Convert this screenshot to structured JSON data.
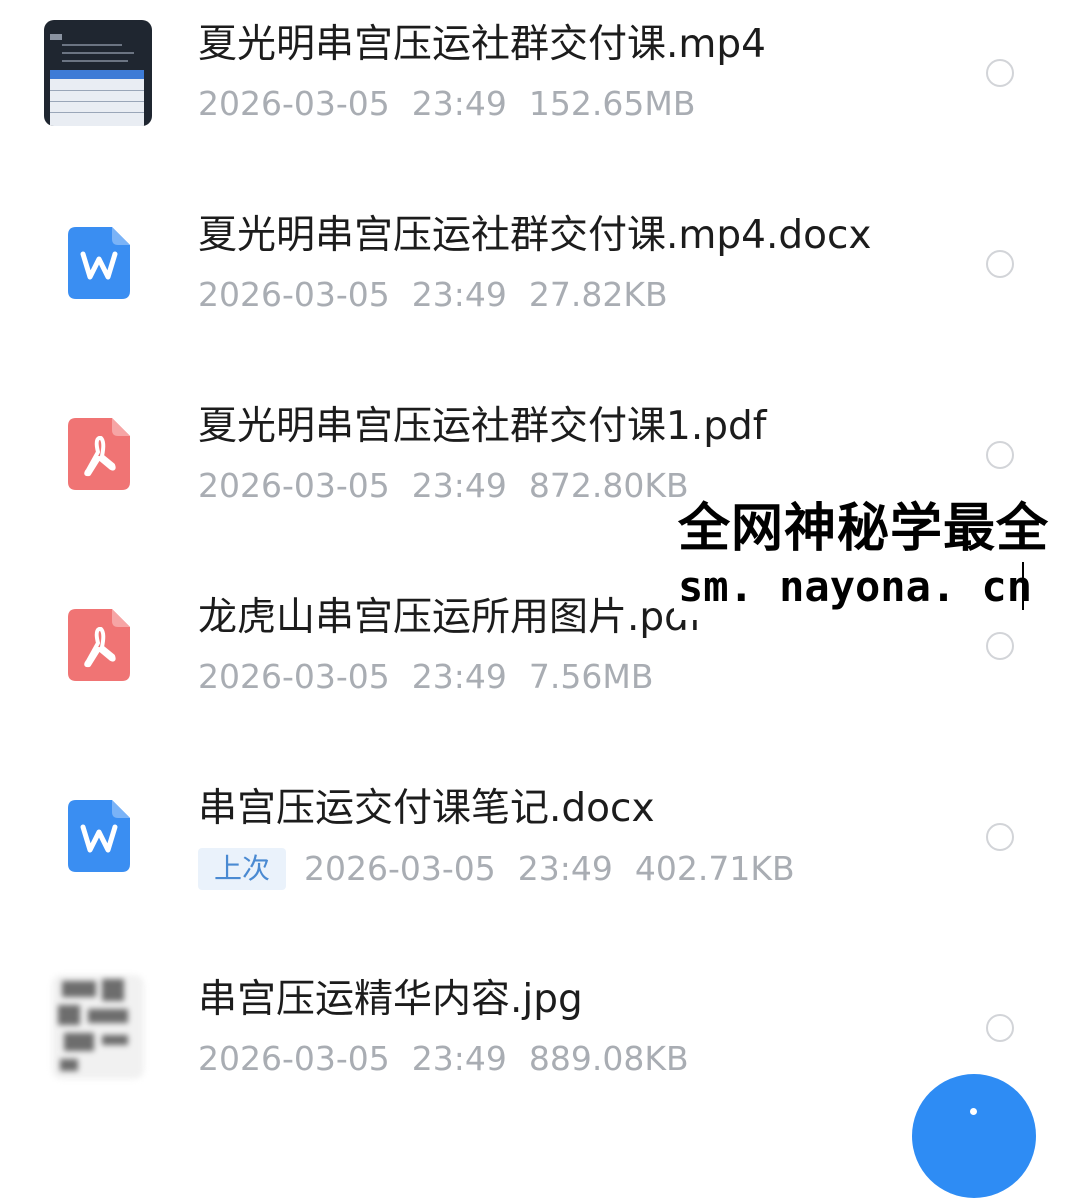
{
  "files": [
    {
      "name": "夏光明串宫压运社群交付课.mp4",
      "date": "2026-03-05",
      "time": "23:49",
      "size": "152.65MB",
      "icon": "video-thumbnail",
      "badge": ""
    },
    {
      "name": "夏光明串宫压运社群交付课.mp4.docx",
      "date": "2026-03-05",
      "time": "23:49",
      "size": "27.82KB",
      "icon": "word-doc-icon",
      "badge": ""
    },
    {
      "name": "夏光明串宫压运社群交付课1.pdf",
      "date": "2026-03-05",
      "time": "23:49",
      "size": "872.80KB",
      "icon": "pdf-icon",
      "badge": ""
    },
    {
      "name": "龙虎山串宫压运所用图片.pdf",
      "date": "2026-03-05",
      "time": "23:49",
      "size": "7.56MB",
      "icon": "pdf-icon",
      "badge": ""
    },
    {
      "name": "串宫压运交付课笔记.docx",
      "date": "2026-03-05",
      "time": "23:49",
      "size": "402.71KB",
      "icon": "word-doc-icon",
      "badge": "上次"
    },
    {
      "name": "串宫压运精华内容.jpg",
      "date": "2026-03-05",
      "time": "23:49",
      "size": "889.08KB",
      "icon": "image-thumbnail",
      "badge": ""
    }
  ],
  "watermark": {
    "title": "全网神秘学最全",
    "url": "sm. nayona. cn"
  },
  "colors": {
    "word_icon": "#3a8ef2",
    "pdf_icon": "#f07474",
    "fab": "#2e8cf4",
    "meta_text": "#a9adb3",
    "badge_text": "#4a8ad2"
  },
  "fab": {
    "icon": "add-icon"
  }
}
